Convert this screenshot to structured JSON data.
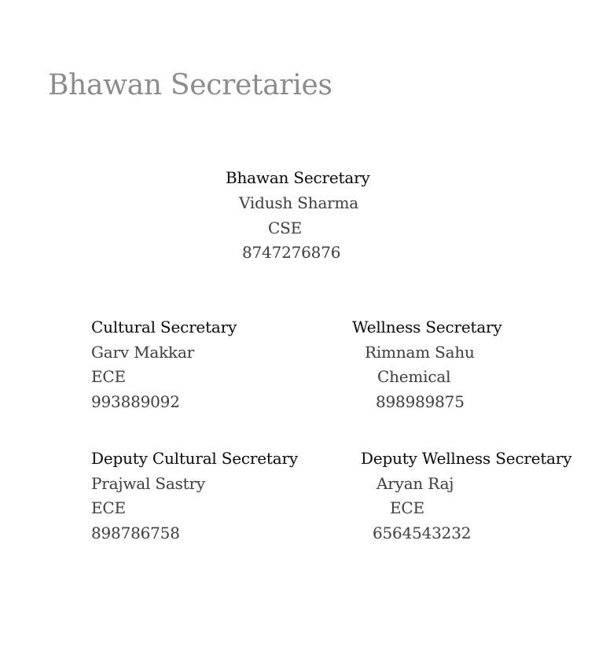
{
  "page": {
    "title": "Bhawan Secretaries"
  },
  "main": {
    "role": "Bhawan Secretary",
    "name": "Vidush Sharma",
    "branch": "CSE",
    "phone": "8747276876"
  },
  "cultural": {
    "role": "Cultural Secretary",
    "name": "Garv Makkar",
    "branch": "ECE",
    "phone": "993889092"
  },
  "wellness": {
    "role": "Wellness Secretary",
    "name": "Rimnam Sahu",
    "branch": "Chemical",
    "phone": "898989875"
  },
  "deputy_cultural": {
    "role": "Deputy Cultural Secretary",
    "name": "Prajwal Sastry",
    "branch": "ECE",
    "phone": "898786758"
  },
  "deputy_wellness": {
    "role": "Deputy Wellness Secretary",
    "name": "Aryan Raj",
    "branch": "ECE",
    "phone": "6564543232"
  }
}
